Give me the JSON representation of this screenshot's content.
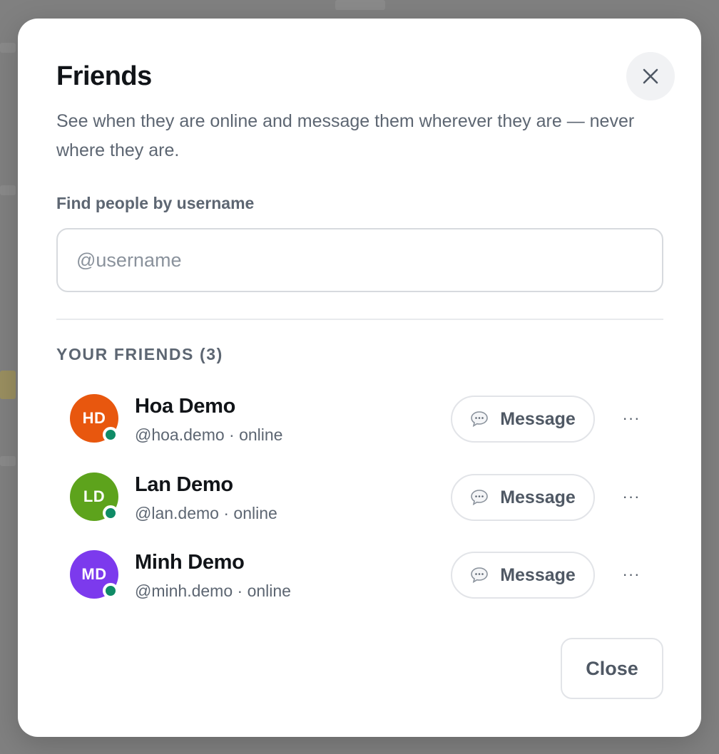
{
  "dialog": {
    "title": "Friends",
    "subtitle": "See when they are online and message them wherever they are — never where they are.",
    "close_icon": "close-icon"
  },
  "search": {
    "label": "Find people by username",
    "placeholder": "@username",
    "value": ""
  },
  "friends_section": {
    "title": "YOUR FRIENDS (3)"
  },
  "friends": [
    {
      "initials": "HD",
      "name": "Hoa Demo",
      "meta": "@hoa.demo · online",
      "avatar_color": "#e8570e",
      "message_label": "Message",
      "more_label": "···"
    },
    {
      "initials": "LD",
      "name": "Lan Demo",
      "meta": "@lan.demo · online",
      "avatar_color": "#5da31c",
      "message_label": "Message",
      "more_label": "···"
    },
    {
      "initials": "MD",
      "name": "Minh Demo",
      "meta": "@minh.demo · online",
      "avatar_color": "#7c3aed",
      "message_label": "Message",
      "more_label": "···"
    }
  ],
  "footer": {
    "close_label": "Close"
  },
  "colors": {
    "online": "#0f8b66",
    "text_primary": "#111418",
    "text_secondary": "#5d6672"
  }
}
